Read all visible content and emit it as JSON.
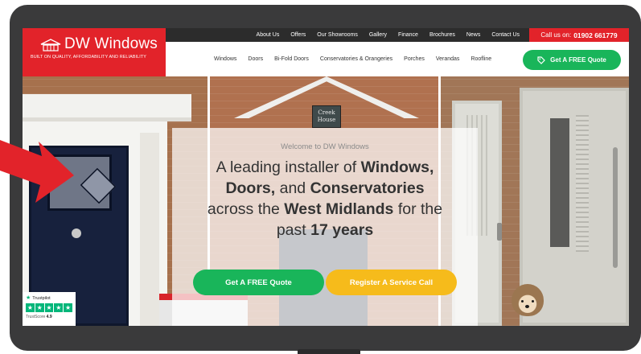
{
  "brand": {
    "name": "DW Windows",
    "tagline": "BUILT ON QUALITY, AFFORDABILITY AND RELIABILITY",
    "primary_color": "#e2232a",
    "accent_green": "#19b55a",
    "accent_yellow": "#f6bb1b"
  },
  "topbar": {
    "links": [
      "About Us",
      "Offers",
      "Our Showrooms",
      "Gallery",
      "Finance",
      "Brochures",
      "News",
      "Contact Us"
    ],
    "call_label": "Call us on:",
    "phone": "01902 661779"
  },
  "nav": {
    "items": [
      "Windows",
      "Doors",
      "Bi-Fold Doors",
      "Conservatories & Orangeries",
      "Porches",
      "Verandas",
      "Roofline"
    ],
    "quote_label": "Get A FREE Quote",
    "quote_icon": "tag-icon"
  },
  "hero": {
    "welcome": "Welcome to DW Windows",
    "headline": {
      "l1a": "A leading installer of ",
      "l1b": "Windows,",
      "l2a": "Doors,",
      "l2b": " and ",
      "l2c": "Conservatories",
      "l3a": "across the ",
      "l3b": "West Midlands",
      "l3c": " for the",
      "l4a": "past ",
      "l4b": "17 years"
    },
    "cta_quote": "Get A FREE Quote",
    "cta_service": "Register A Service Call",
    "house_sign": [
      "Creek",
      "House"
    ]
  },
  "trustpilot": {
    "brand": "Trustpilot",
    "score_label": "TrustScore",
    "score": "4.9",
    "stars": 5
  }
}
